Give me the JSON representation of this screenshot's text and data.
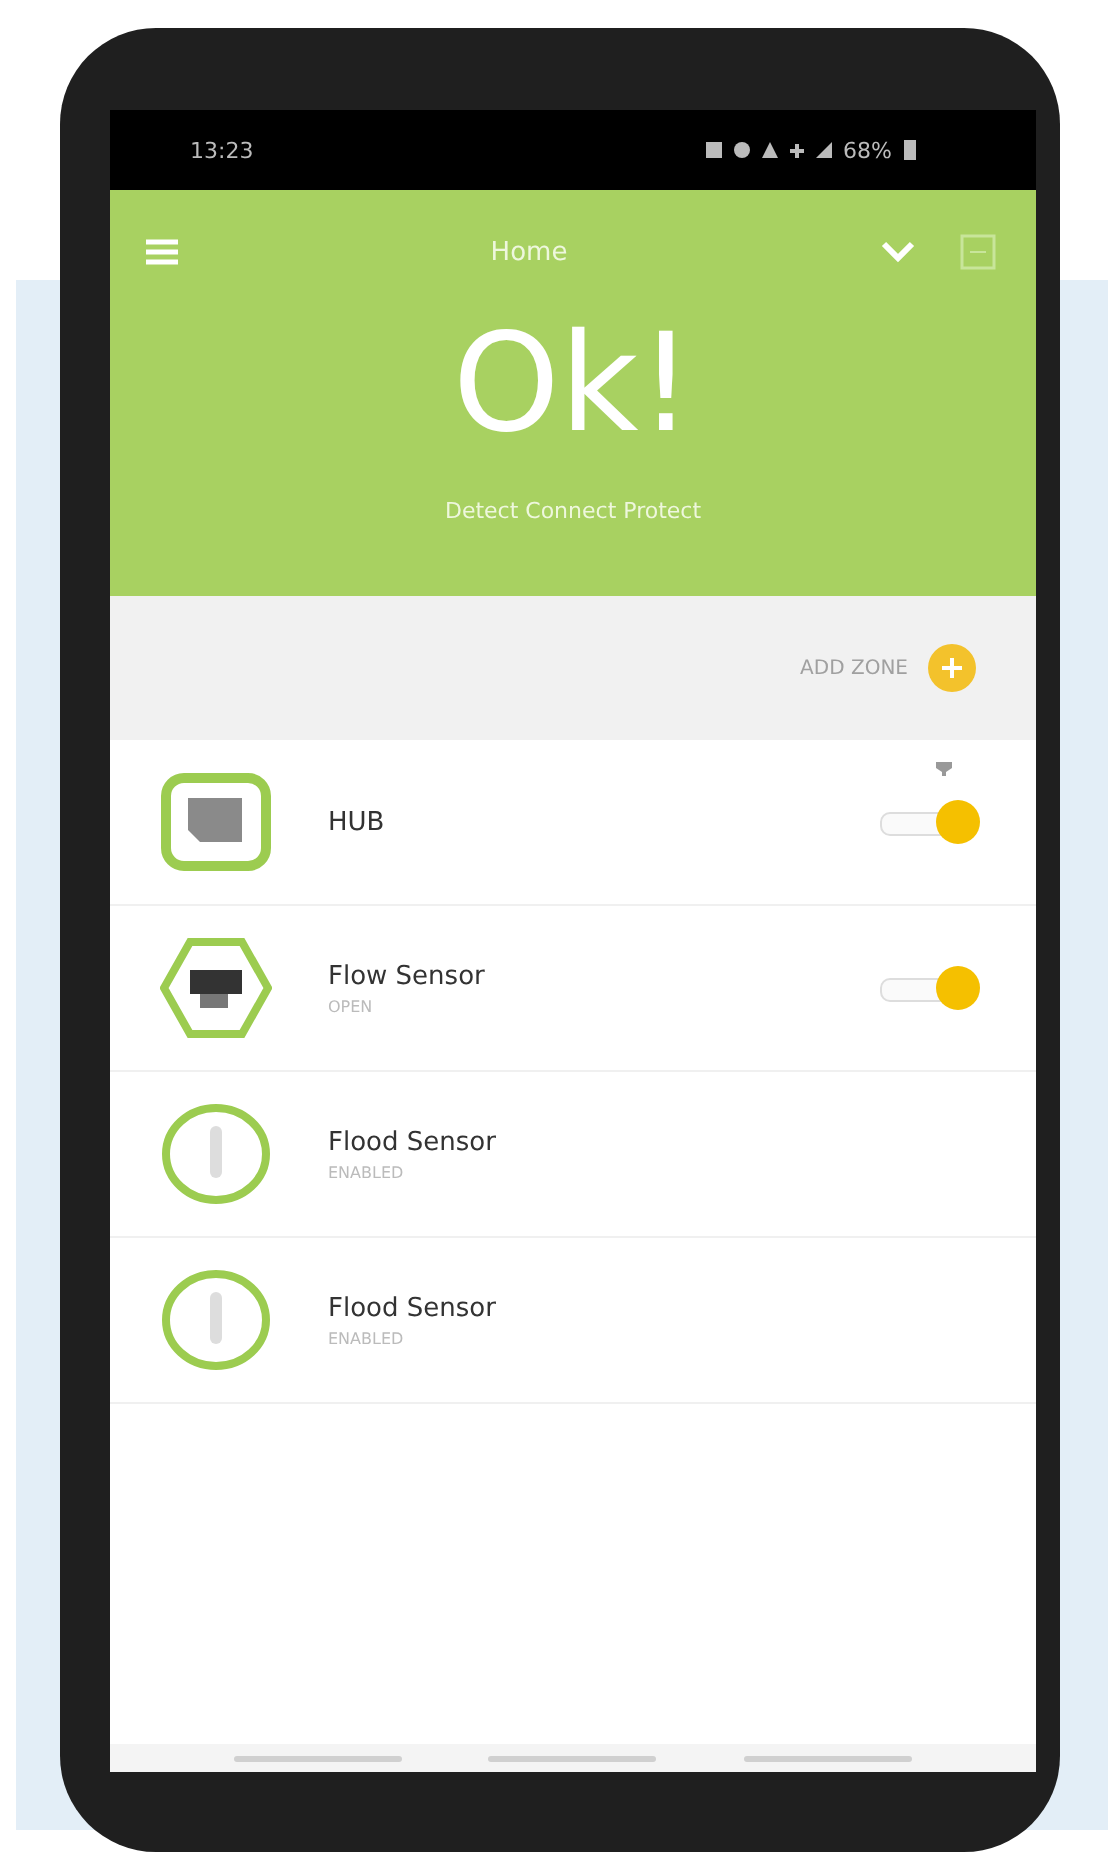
{
  "status_bar": {
    "time": "13:23",
    "battery": "68%"
  },
  "header": {
    "title": "Home",
    "status": "Ok!",
    "tagline": "Detect Connect Protect"
  },
  "add_zone": {
    "label": "ADD ZONE"
  },
  "devices": [
    {
      "name": "HUB",
      "kind": "hub",
      "switch": {
        "on": true
      }
    },
    {
      "name": "Flow Sensor",
      "kind": "flow",
      "state": "OPEN",
      "switch": {
        "on": true
      }
    },
    {
      "name": "Flood Sensor",
      "kind": "flood",
      "state": "ENABLED"
    },
    {
      "name": "Flood Sensor",
      "kind": "flood",
      "state": "ENABLED"
    }
  ]
}
